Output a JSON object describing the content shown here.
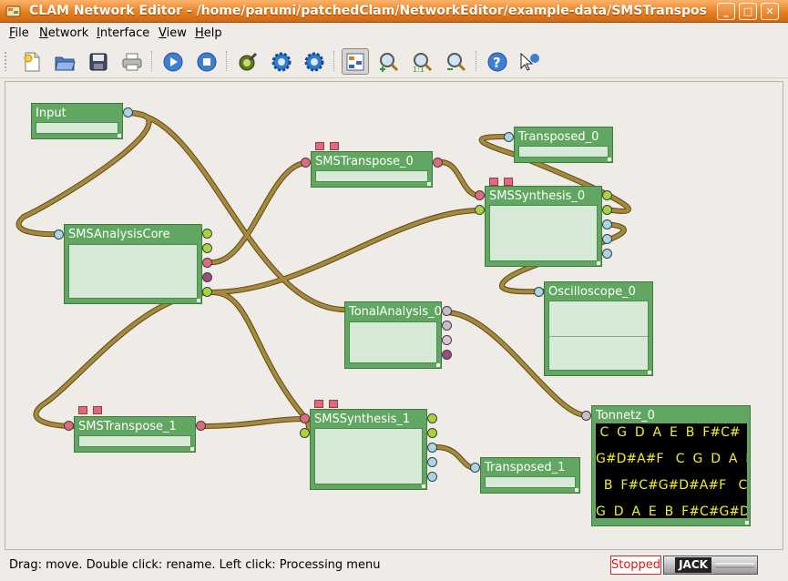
{
  "window": {
    "title": "CLAM Network Editor - /home/parumi/patchedClam/NetworkEditor/example-data/SMSTransposition.clamnetwork",
    "minimize": "_",
    "maximize": "□",
    "close": "✕"
  },
  "menu": [
    {
      "label": "File"
    },
    {
      "label": "Network"
    },
    {
      "label": "Interface"
    },
    {
      "label": "View"
    },
    {
      "label": "Help"
    }
  ],
  "toolbar": {
    "icons": [
      "new-file-icon",
      "open-folder-icon",
      "save-icon",
      "print-icon",
      "play-icon",
      "stop-icon",
      "wrench-icon",
      "gear-icon",
      "gear-alt-icon",
      "fit-network-icon",
      "zoom-in-icon",
      "zoom-reset-icon",
      "zoom-out-icon",
      "help-icon",
      "whats-this-icon"
    ],
    "zoom_reset_label": "1:1"
  },
  "processings": {
    "input": {
      "name": "Input"
    },
    "analysis": {
      "name": "SMSAnalysisCore"
    },
    "transpose0": {
      "name": "SMSTranspose_0"
    },
    "synth0": {
      "name": "SMSSynthesis_0"
    },
    "transposed0": {
      "name": "Transposed_0"
    },
    "scope": {
      "name": "Oscilloscope_0"
    },
    "tonal": {
      "name": "TonalAnalysis_0"
    },
    "transpose1": {
      "name": "SMSTranspose_1"
    },
    "synth1": {
      "name": "SMSSynthesis_1"
    },
    "transposed1": {
      "name": "Transposed_1"
    },
    "tonnetz": {
      "name": "Tonnetz_0",
      "rows": [
        " C  G  D  A  E  B  F#C#",
        "G#D#A#F   C  G  D  A  E",
        "  B  F#C#G#D#A#F   C  G",
        "G  D  A  E  B  F#C#G#D#"
      ]
    }
  },
  "colors": {
    "processing": "#61a661",
    "audio_port": "#a8d43a",
    "control_port": "#e36a7c",
    "wire": "#9c8038",
    "tonnetz_note": "#f2ed35"
  },
  "status": {
    "message": "Drag: move. Double click: rename. Left click: Processing menu",
    "state": "Stopped",
    "jack": "JACK"
  }
}
